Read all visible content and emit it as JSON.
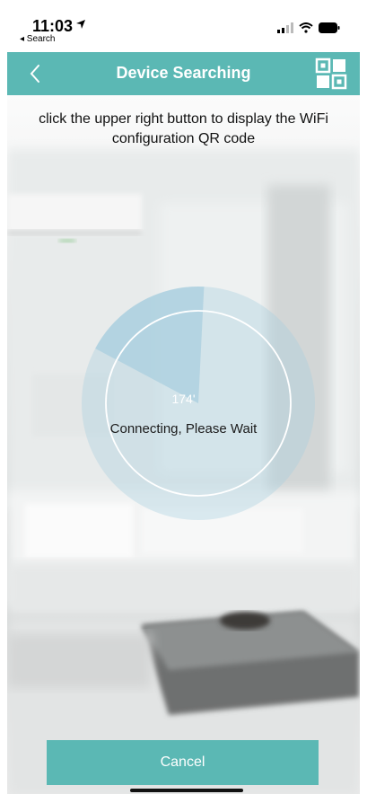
{
  "status_bar": {
    "time": "11:03",
    "back_label": "◂ Search",
    "icons": [
      "location-arrow-icon",
      "signal-icon",
      "wifi-icon",
      "battery-icon"
    ]
  },
  "navbar": {
    "title": "Device Searching",
    "back_icon": "chevron-left-icon",
    "qr_icon": "qr-code-icon",
    "color": "#5bb8b4"
  },
  "main": {
    "instruction": "click the upper right button to display the WiFi configuration QR code",
    "count": "174'",
    "status": "Connecting, Please Wait",
    "progress_fraction": 0.18,
    "progress_color": "#a9cfdf"
  },
  "footer": {
    "cancel_label": "Cancel",
    "button_color": "#5bb8b4"
  }
}
